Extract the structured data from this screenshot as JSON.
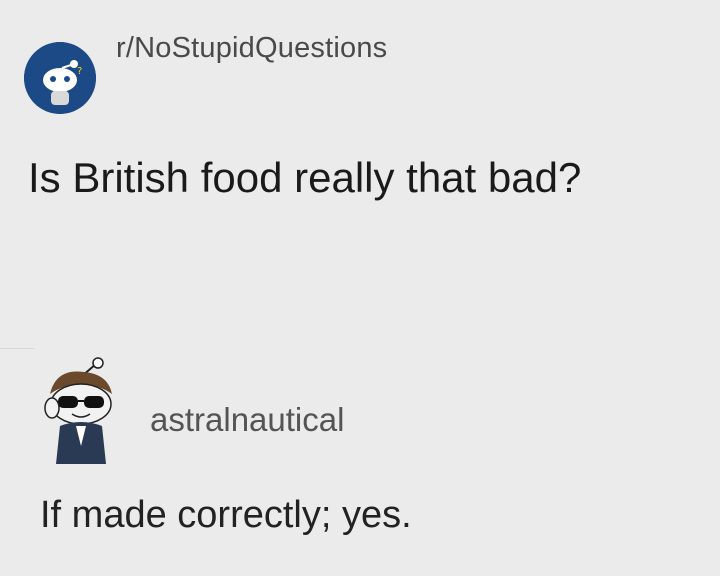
{
  "post": {
    "subreddit": "r/NoStupidQuestions",
    "title": "Is British food really that bad?"
  },
  "comment": {
    "username": "astralnautical",
    "text": "If made correctly; yes."
  },
  "icons": {
    "subreddit_avatar": "subreddit-snoo-icon",
    "user_avatar": "snoo-sunglasses-avatar"
  },
  "colors": {
    "background": "#ebebeb",
    "subreddit_avatar_bg": "#1b4a86",
    "text_primary": "#1a1a1b",
    "text_secondary": "#545454"
  }
}
